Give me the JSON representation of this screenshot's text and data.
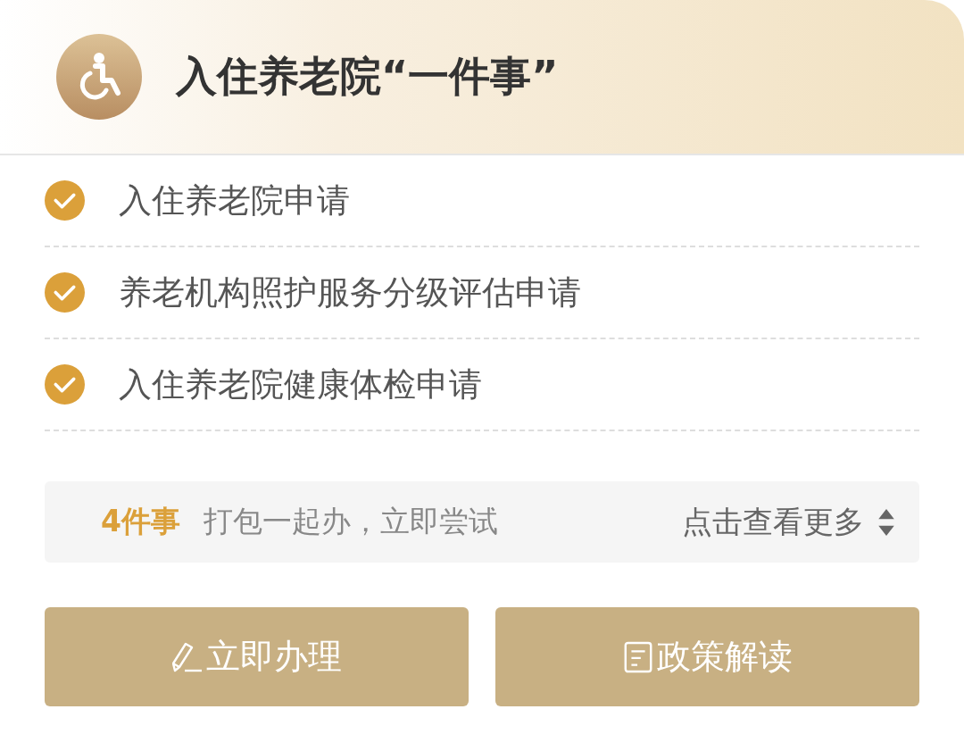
{
  "header": {
    "title": "入住养老院“一件事”"
  },
  "items": [
    {
      "label": "入住养老院申请",
      "checked": true
    },
    {
      "label": "养老机构照护服务分级评估申请",
      "checked": true
    },
    {
      "label": "入住养老院健康体检申请",
      "checked": true
    }
  ],
  "summary": {
    "count": "4件事",
    "text": "打包一起办，立即尝试",
    "more": "点击查看更多"
  },
  "buttons": [
    {
      "label": "立即办理",
      "kind": "apply"
    },
    {
      "label": "政策解读",
      "kind": "policy"
    }
  ]
}
